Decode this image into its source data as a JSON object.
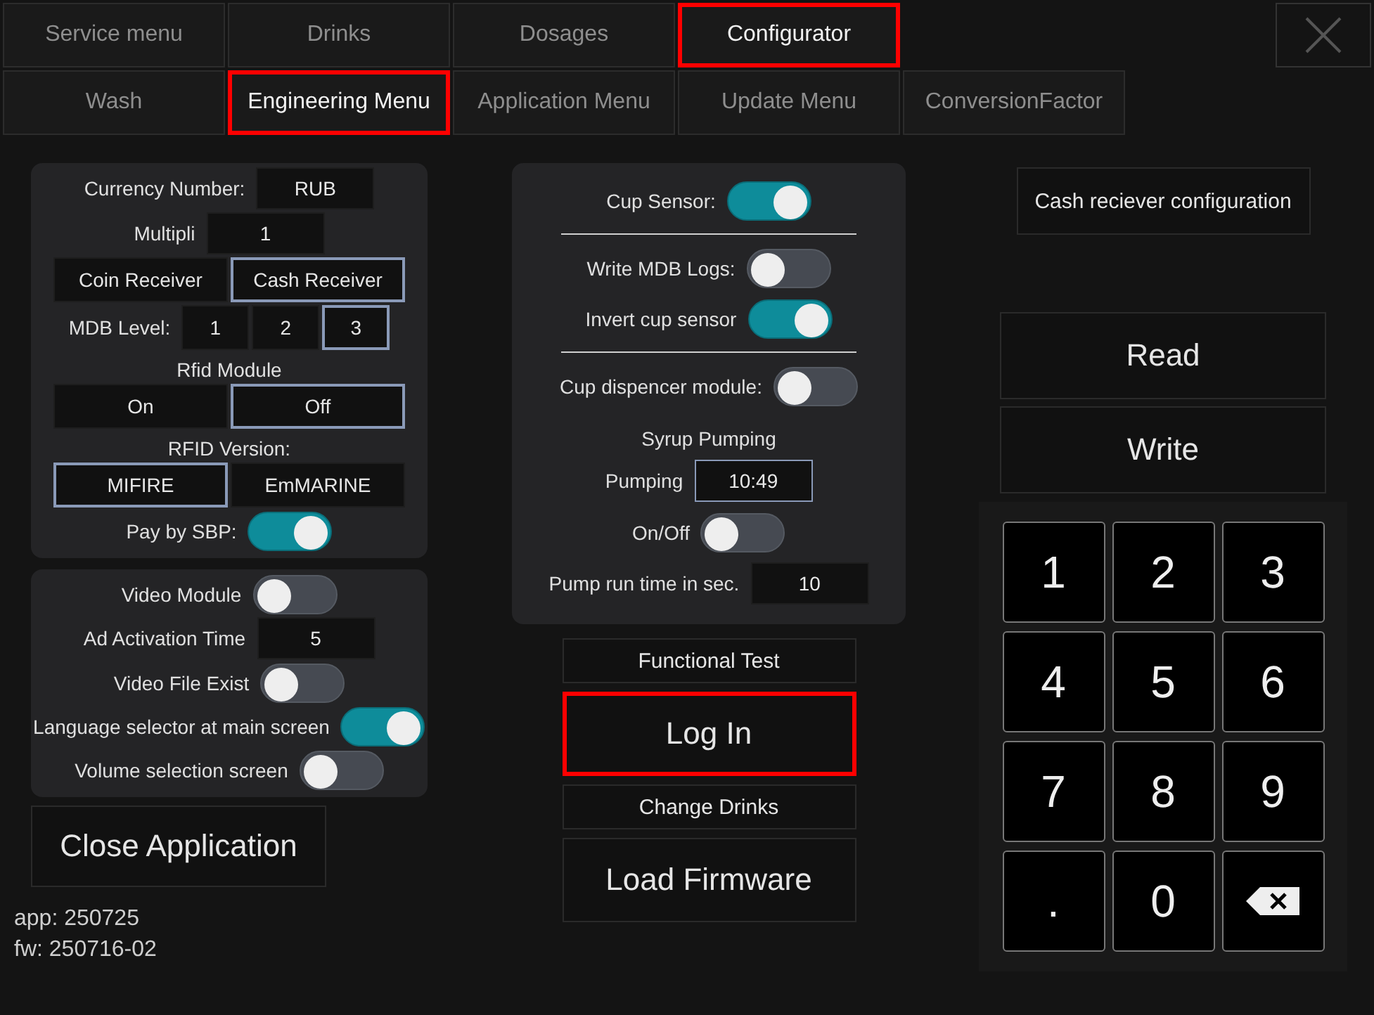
{
  "top_tabs": [
    {
      "label": "Service menu",
      "selected": false,
      "highlighted": false
    },
    {
      "label": "Drinks",
      "selected": false,
      "highlighted": false
    },
    {
      "label": "Dosages",
      "selected": false,
      "highlighted": false
    },
    {
      "label": "Configurator",
      "selected": true,
      "highlighted": true
    }
  ],
  "sub_tabs": [
    {
      "label": "Wash",
      "selected": false,
      "highlighted": false
    },
    {
      "label": "Engineering Menu",
      "selected": true,
      "highlighted": true
    },
    {
      "label": "Application Menu",
      "selected": false,
      "highlighted": false
    },
    {
      "label": "Update Menu",
      "selected": false,
      "highlighted": false
    },
    {
      "label": "ConversionFactor",
      "selected": false,
      "highlighted": false
    }
  ],
  "payment_panel": [
    {
      "kind": "field",
      "label": "Currency Number:",
      "value": "RUB"
    },
    {
      "kind": "field",
      "label": "Multipli",
      "value": "1"
    },
    {
      "kind": "choice_row",
      "options": [
        {
          "label": "Coin Receiver",
          "selected": false
        },
        {
          "label": "Cash Receiver",
          "selected": true
        }
      ]
    },
    {
      "kind": "choice_row",
      "label": "MDB Level:",
      "options": [
        {
          "label": "1",
          "selected": false
        },
        {
          "label": "2",
          "selected": false
        },
        {
          "label": "3",
          "selected": true
        }
      ]
    },
    {
      "kind": "choice_block",
      "label": "Rfid Module",
      "options": [
        {
          "label": "On",
          "selected": false
        },
        {
          "label": "Off",
          "selected": true
        }
      ]
    },
    {
      "kind": "choice_block",
      "label": "RFID Version:",
      "options": [
        {
          "label": "MIFIRE",
          "selected": true
        },
        {
          "label": "EmMARINE",
          "selected": false
        }
      ]
    },
    {
      "kind": "toggle",
      "label": "Pay by SBP:",
      "on": true
    }
  ],
  "video_panel": [
    {
      "kind": "toggle",
      "label": "Video Module",
      "on": false
    },
    {
      "kind": "field",
      "label": "Ad Activation Time",
      "value": "5"
    },
    {
      "kind": "toggle",
      "label": "Video File Exist",
      "on": false
    },
    {
      "kind": "toggle",
      "label": "Language selector at main screen",
      "on": true
    },
    {
      "kind": "toggle",
      "label": "Volume selection screen",
      "on": false
    }
  ],
  "close_application": "Close Application",
  "versions": [
    "app: 250725",
    "fw: 250716-02"
  ],
  "cup_panel": [
    {
      "kind": "toggle",
      "label": "Cup Sensor:",
      "on": true
    },
    {
      "kind": "divider"
    },
    {
      "kind": "toggle",
      "label": "Write MDB Logs:",
      "on": false
    },
    {
      "kind": "toggle",
      "label": "Invert cup sensor",
      "on": true
    },
    {
      "kind": "divider"
    },
    {
      "kind": "toggle",
      "label": "Cup dispencer module:",
      "on": false
    },
    {
      "kind": "heading",
      "label": "Syrup Pumping"
    },
    {
      "kind": "field",
      "label": "Pumping",
      "value": "10:49",
      "focused": true
    },
    {
      "kind": "toggle",
      "label": "On/Off",
      "on": false
    },
    {
      "kind": "field",
      "label": "Pump run time in sec.",
      "value": "10",
      "focused": false
    }
  ],
  "center_buttons": [
    {
      "label": "Functional Test",
      "kind": "small",
      "highlighted": false
    },
    {
      "label": "Log In",
      "kind": "large",
      "highlighted": true
    },
    {
      "label": "Change Drinks",
      "kind": "small",
      "highlighted": false
    },
    {
      "label": "Load Firmware",
      "kind": "large",
      "highlighted": false
    }
  ],
  "cash_config_button": "Cash reciever configuration",
  "read_button": "Read",
  "write_button": "Write",
  "keypad": [
    {
      "kind": "char",
      "label": "1"
    },
    {
      "kind": "char",
      "label": "2"
    },
    {
      "kind": "char",
      "label": "3"
    },
    {
      "kind": "char",
      "label": "4"
    },
    {
      "kind": "char",
      "label": "5"
    },
    {
      "kind": "char",
      "label": "6"
    },
    {
      "kind": "char",
      "label": "7"
    },
    {
      "kind": "char",
      "label": "8"
    },
    {
      "kind": "char",
      "label": "9"
    },
    {
      "kind": "char",
      "label": "."
    },
    {
      "kind": "char",
      "label": "0"
    },
    {
      "kind": "backspace"
    }
  ]
}
